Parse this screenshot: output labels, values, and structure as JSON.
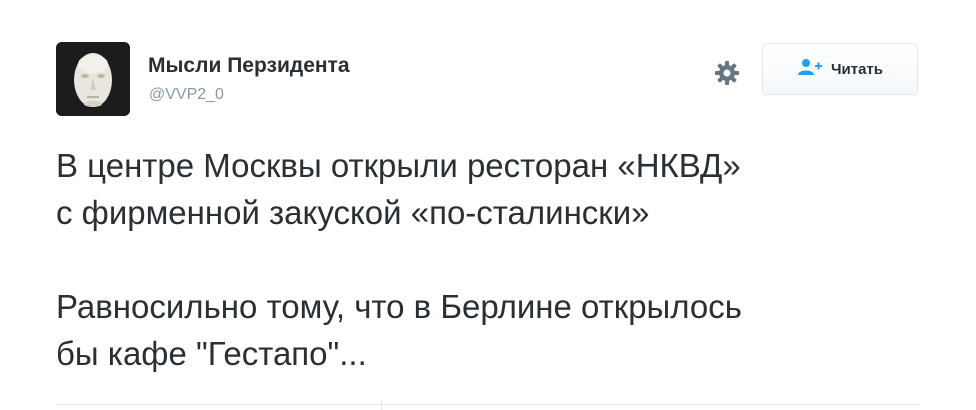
{
  "author": {
    "display_name": "Мысли Перзидента",
    "handle": "@VVP2_0",
    "avatar_icon": "death-mask-avatar"
  },
  "actions": {
    "settings_icon": "gear-icon",
    "follow_icon": "add-user-icon",
    "follow_label": "Читать"
  },
  "tweet": {
    "line1": "В центре Москвы открыли ресторан «НКВД»",
    "line2": "с фирменной закуской «по-сталински»",
    "line3": "Равносильно тому, что в Берлине открылось",
    "line4": "бы кафе \"Гестапо\"..."
  },
  "colors": {
    "text": "#292f33",
    "muted": "#8899a6",
    "accent": "#1da1f2",
    "border": "#e1e8ed"
  }
}
